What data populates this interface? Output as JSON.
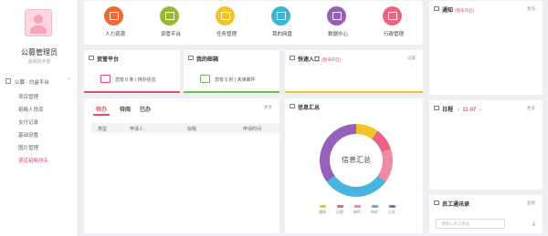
{
  "sidebar": {
    "username": "公募管理员",
    "subtitle": "金融技术部",
    "group_label": "公募 · 白盒平台",
    "items": [
      {
        "label": "项目管理"
      },
      {
        "label": "韬略人员库"
      },
      {
        "label": "支付记录"
      },
      {
        "label": "基础设置"
      },
      {
        "label": "图片管理"
      },
      {
        "label": "渠道韬略排名"
      }
    ]
  },
  "quick_links": [
    {
      "label": "人力资源",
      "color": "#ef6a34"
    },
    {
      "label": "资管平台",
      "color": "#9ab835"
    },
    {
      "label": "任务管理",
      "color": "#f3c32c"
    },
    {
      "label": "我的网盘",
      "color": "#3cb6d8"
    },
    {
      "label": "数据中心",
      "color": "#9560b9"
    },
    {
      "label": "行政管理",
      "color": "#ea6380"
    }
  ],
  "cards": {
    "asset_platform": {
      "title": "资管平台",
      "text": "您有 0 条 | 待办信息",
      "count": "0"
    },
    "mail": {
      "title": "我的邮箱",
      "text": "您有 0 封 | 未读邮件",
      "count": "0"
    },
    "shortcut": {
      "title": "快速入口",
      "tag": "(暂未开启)",
      "more": "设置"
    },
    "notice": {
      "title": "通知",
      "tag": "(暂未开启)",
      "more": "更多"
    },
    "todo": {
      "tabs": [
        "待办",
        "待阅",
        "已办"
      ],
      "more": "更多",
      "columns": [
        "类型",
        "申请人",
        "标题",
        "申请时间"
      ]
    },
    "info": {
      "title": "信息汇总",
      "center": "信息汇总"
    },
    "calendar": {
      "title": "日程",
      "date": "11-07",
      "more": "更多"
    },
    "contacts": {
      "title": "员工通讯录",
      "more": "查看",
      "search_placeholder": "请输入员工姓名"
    }
  },
  "chart_data": {
    "type": "pie",
    "title": "信息汇总",
    "categories": [
      "通知",
      "日程",
      "邮件",
      "待办",
      "公告"
    ],
    "values": [
      10,
      10,
      15,
      30,
      35
    ],
    "colors": [
      "#f3c32c",
      "#ea6380",
      "#f18aa5",
      "#47b5e0",
      "#9561b9"
    ]
  }
}
